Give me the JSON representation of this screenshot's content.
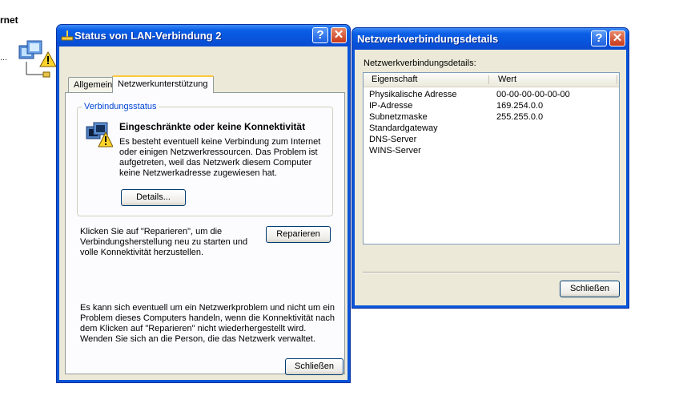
{
  "background": {
    "title": "rnet",
    "dots": "..."
  },
  "status_window": {
    "title": "Status von LAN-Verbindung 2",
    "tabs": [
      {
        "label": "Allgemein"
      },
      {
        "label": "Netzwerkunterstützung"
      }
    ],
    "group_label": "Verbindungsstatus",
    "warning_heading": "Eingeschränkte oder keine Konnektivität",
    "warning_lines": [
      "Es besteht eventuell keine Verbindung zum Internet",
      "oder einigen Netzwerkressourcen. Das Problem ist",
      "aufgetreten, weil das Netzwerk diesem Computer",
      "keine Netzwerkadresse zugewiesen hat."
    ],
    "details_button": "Details...",
    "repair_lines": [
      "Klicken Sie auf \"Reparieren\", um die",
      "Verbindungsherstellung neu zu starten und",
      "volle Konnektivität herzustellen."
    ],
    "repair_button": "Reparieren",
    "help_lines": [
      "Es kann sich eventuell um ein Netzwerkproblem und nicht um ein",
      "Problem dieses Computers handeln, wenn die Konnektivität nach",
      "dem Klicken auf \"Reparieren\" nicht wiederhergestellt wird.",
      "Wenden Sie sich an die Person, die das Netzwerk verwaltet."
    ],
    "close_button": "Schließen"
  },
  "details_window": {
    "title": "Netzwerkverbindungsdetails",
    "label": "Netzwerkverbindungsdetails:",
    "columns": [
      "Eigenschaft",
      "Wert"
    ],
    "rows": [
      {
        "property": "Physikalische Adresse",
        "value": "00-00-00-00-00-00"
      },
      {
        "property": "IP-Adresse",
        "value": "169.254.0.0"
      },
      {
        "property": "Subnetzmaske",
        "value": "255.255.0.0"
      },
      {
        "property": "Standardgateway",
        "value": ""
      },
      {
        "property": "DNS-Server",
        "value": ""
      },
      {
        "property": "WINS-Server",
        "value": ""
      }
    ],
    "close_button": "Schließen"
  },
  "icons": {
    "help": "?",
    "close": "✕"
  },
  "colors": {
    "titlebar_active": "#0a5fe6",
    "titlebar_inactive": "#8fadec",
    "dialog_face": "#ece9d8",
    "group_label": "#0046d5",
    "tab_highlight": "#ffc83c"
  }
}
